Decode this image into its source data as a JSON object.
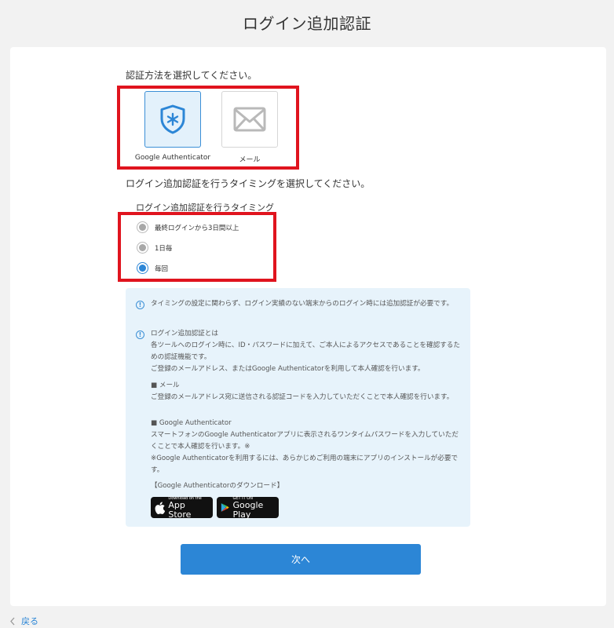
{
  "page": {
    "title": "ログイン追加認証"
  },
  "method": {
    "label": "認証方法を選択してください。",
    "options": [
      {
        "label": "Google Authenticator",
        "selected": true
      },
      {
        "label": "メール",
        "selected": false
      }
    ]
  },
  "timing": {
    "label": "ログイン追加認証を行うタイミングを選択してください。",
    "group_title": "ログイン追加認証を行うタイミング",
    "options": [
      {
        "label": "最終ログインから3日間以上",
        "checked": false
      },
      {
        "label": "1日毎",
        "checked": false
      },
      {
        "label": "毎回",
        "checked": true
      }
    ]
  },
  "info": {
    "note1": "タイミングの設定に関わらず、ログイン実績のない端末からのログイン時には追加認証が必要です。",
    "note2_title": "ログイン追加認証とは",
    "note2_body": "各ツールへのログイン時に、ID・パスワードに加えて、ご本人によるアクセスであることを確認するための認証機能です。",
    "note2_body2": "ご登録のメールアドレス、またはGoogle Authenticatorを利用して本人確認を行います。",
    "mail_heading": "■ メール",
    "mail_body": "ご登録のメールアドレス宛に送信される認証コードを入力していただくことで本人確認を行います。",
    "ga_heading": "■ Google Authenticator",
    "ga_body": "スマートフォンのGoogle Authenticatorアプリに表示されるワンタイムパスワードを入力していただくことで本人確認を行います。※",
    "ga_note": "※Google Authenticatorを利用するには、あらかじめご利用の端末にアプリのインストールが必要です。",
    "download_label": "【Google Authenticatorのダウンロード】",
    "app_store": {
      "small": "Download on the",
      "big": "App Store"
    },
    "google_play": {
      "small": "GET IT ON",
      "big": "Google Play"
    }
  },
  "actions": {
    "next": "次へ",
    "back": "戻る"
  },
  "colors": {
    "accent": "#2c86d6",
    "highlight_border": "#e0141e",
    "info_bg": "#e7f3fb"
  }
}
